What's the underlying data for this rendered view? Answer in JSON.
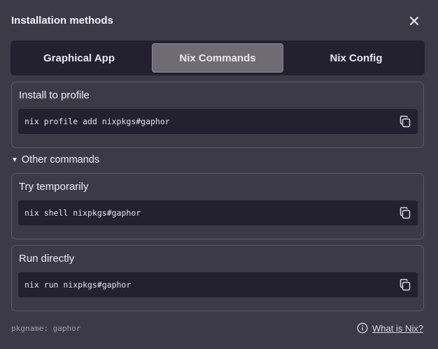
{
  "dialog": {
    "title": "Installation methods",
    "close_icon": "close-icon"
  },
  "tabs": [
    {
      "label": "Graphical App",
      "selected": false
    },
    {
      "label": "Nix Commands",
      "selected": true
    },
    {
      "label": "Nix Config",
      "selected": false
    }
  ],
  "profile": {
    "heading": "Install to profile",
    "command": "nix profile add nixpkgs#gaphor"
  },
  "other": {
    "label": "Other commands",
    "expanded": true,
    "temporary": {
      "heading": "Try temporarily",
      "command": "nix shell nixpkgs#gaphor"
    },
    "run": {
      "heading": "Run directly",
      "command": "nix run nixpkgs#gaphor"
    }
  },
  "footer": {
    "pkgname": "pkgname: gaphor",
    "help_link": "What is Nix?",
    "help_icon": "info-circle-icon"
  },
  "colors": {
    "background": "#3d3a48",
    "panel": "#232130",
    "selected_tab": "#6e6b74",
    "border": "#5c5968"
  }
}
